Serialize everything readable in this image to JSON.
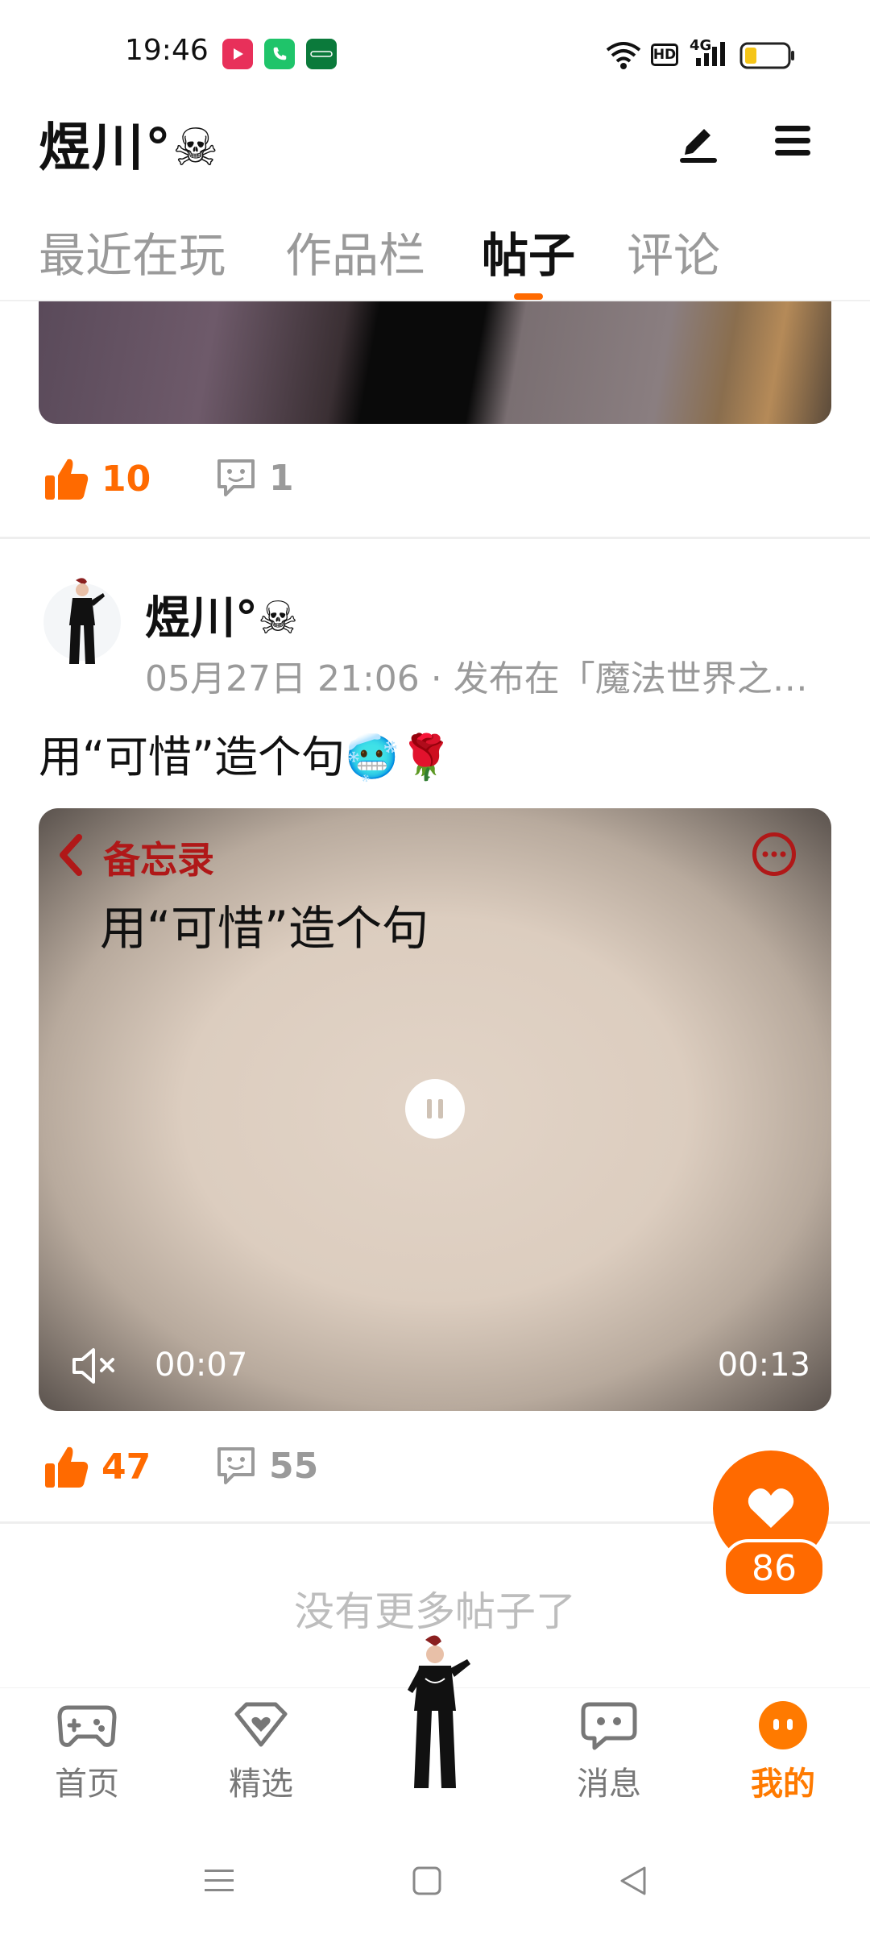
{
  "status_bar": {
    "time": "19:46",
    "indicators": [
      "wifi-icon",
      "hd-icon",
      "4g-signal-icon",
      "battery-icon"
    ],
    "network_label": "HD",
    "network_type": "4G"
  },
  "header": {
    "title": "煜川°☠",
    "actions": [
      "edit-icon",
      "menu-icon"
    ]
  },
  "tabs": [
    {
      "label": "最近在玩",
      "active": false
    },
    {
      "label": "作品栏",
      "active": false
    },
    {
      "label": "帖子",
      "active": true
    },
    {
      "label": "评论",
      "active": false
    }
  ],
  "previous_post": {
    "likes": "10",
    "comments": "1"
  },
  "post": {
    "author": "煜川°☠",
    "meta": "05月27日 21:06 · 发布在「魔法世界之…",
    "text": "用“可惜”造个句🥶🌹",
    "video": {
      "memo_label": "备忘录",
      "memo_title": "用“可惜”造个句",
      "current_time": "00:07",
      "total_time": "00:13",
      "muted": true,
      "playing": true
    },
    "likes": "47",
    "comments": "55"
  },
  "floating_like": {
    "count": "86"
  },
  "footer_text": "没有更多帖子了",
  "bottom_nav": [
    {
      "label": "首页",
      "icon": "gamepad-icon",
      "active": false
    },
    {
      "label": "精选",
      "icon": "heart-gem-icon",
      "active": false
    },
    {
      "label": "",
      "icon": "avatar-center",
      "active": false
    },
    {
      "label": "消息",
      "icon": "chat-bubble-icon",
      "active": false
    },
    {
      "label": "我的",
      "icon": "smiley-face-icon",
      "active": true
    }
  ],
  "colors": {
    "accent": "#ff6a00",
    "memo_red": "#b01818",
    "muted_text": "#9a9a9a"
  }
}
